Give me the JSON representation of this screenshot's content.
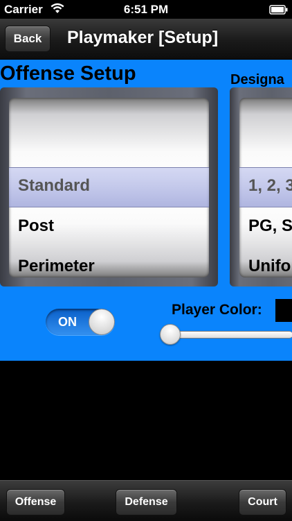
{
  "status_bar": {
    "carrier": "Carrier",
    "time": "6:51 PM",
    "wifi_icon": "wifi-icon",
    "battery_icon": "battery-icon"
  },
  "nav": {
    "back_label": "Back",
    "title": "Playmaker [Setup]"
  },
  "offense_setup": {
    "title": "Offense Setup",
    "options": [
      "Standard",
      "Post",
      "Perimeter"
    ],
    "selected": "Standard"
  },
  "designation": {
    "title": "Designa",
    "options": [
      "1, 2, 3",
      "PG, S",
      "Unifo"
    ],
    "selected": "1, 2, 3"
  },
  "toggle": {
    "label": "ON",
    "state": "on"
  },
  "player_color": {
    "label": "Player Color:",
    "swatch_color": "#000000",
    "slider_value": 0
  },
  "toolbar": {
    "offense_label": "Offense",
    "defense_label": "Defense",
    "court_label": "Court"
  },
  "colors": {
    "panel_blue": "#0a84fc",
    "background": "#000000"
  }
}
